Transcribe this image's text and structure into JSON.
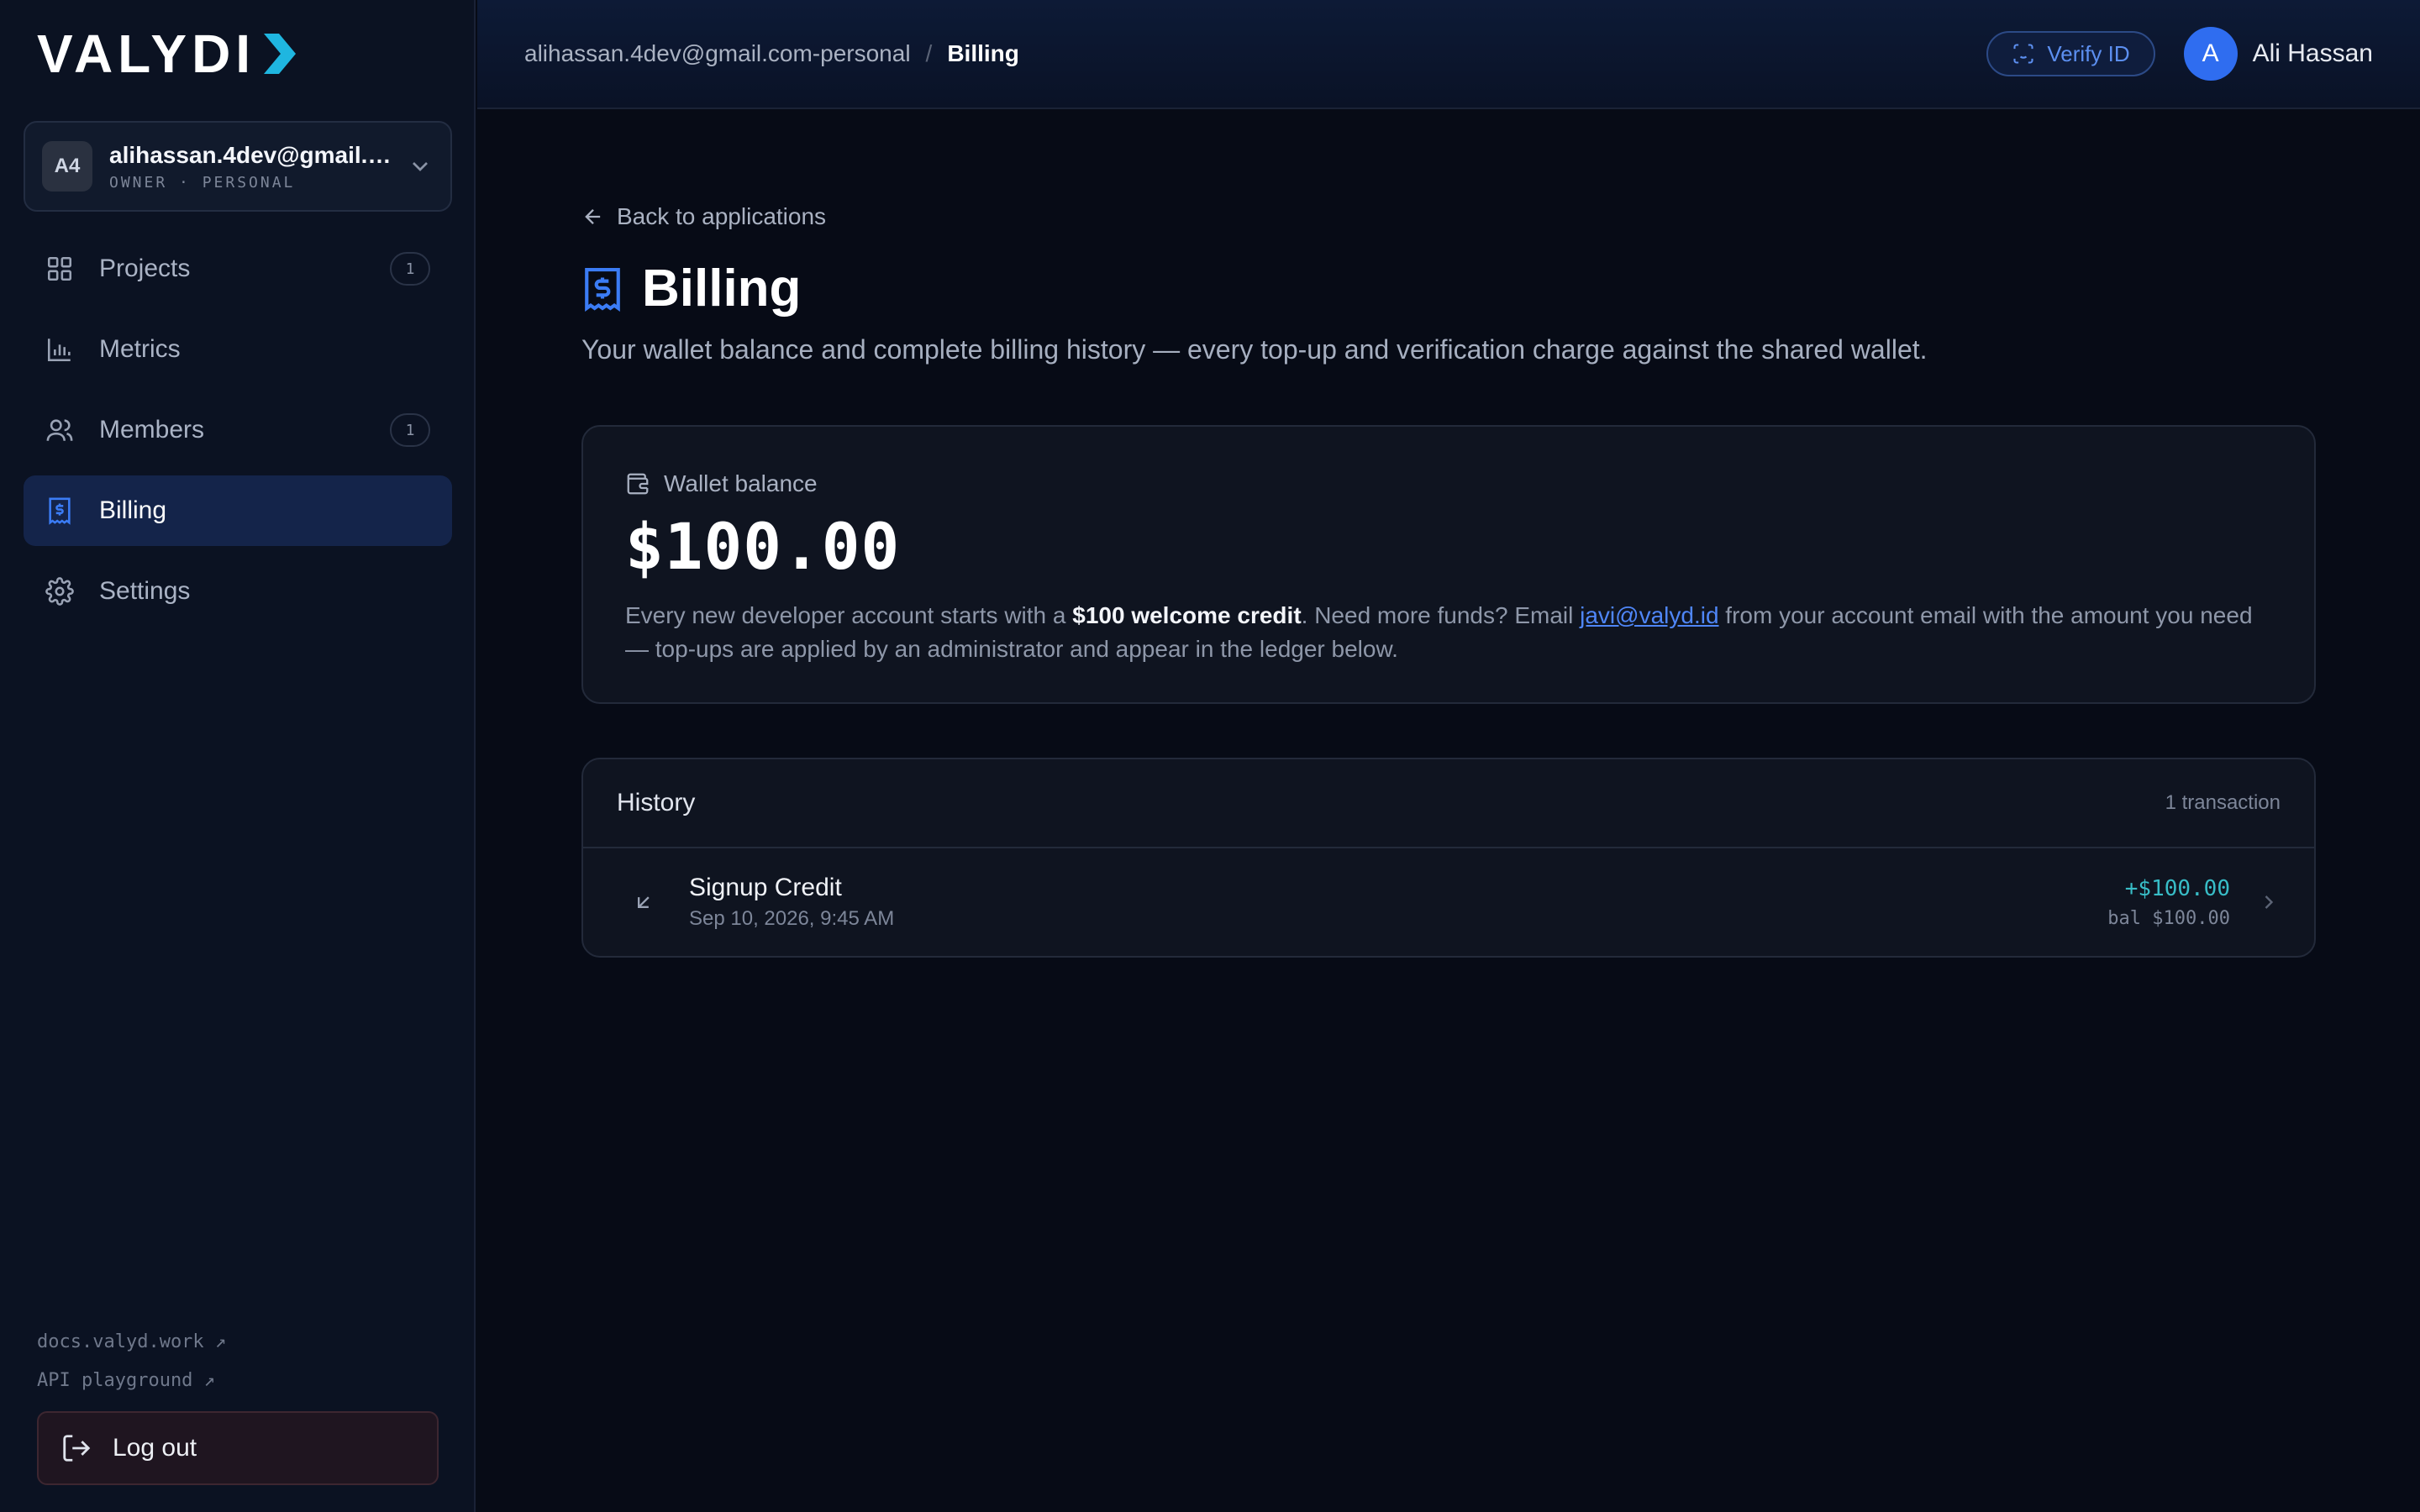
{
  "brand": {
    "logo_text": "VALYDI"
  },
  "account": {
    "avatar_initials": "A4",
    "email": "alihassan.4dev@gmail.c...",
    "role": "OWNER · PERSONAL"
  },
  "nav": {
    "items": [
      {
        "label": "Projects",
        "icon": "grid-icon",
        "badge": "1"
      },
      {
        "label": "Metrics",
        "icon": "bar-chart-icon"
      },
      {
        "label": "Members",
        "icon": "users-icon",
        "badge": "1"
      },
      {
        "label": "Billing",
        "icon": "receipt-dollar-icon",
        "active": true
      },
      {
        "label": "Settings",
        "icon": "gear-icon"
      }
    ]
  },
  "footer": {
    "docs_link": "docs.valyd.work ↗",
    "playground_link": "API playground ↗",
    "logout_label": "Log out"
  },
  "topbar": {
    "breadcrumb_parent": "alihassan.4dev@gmail.com-personal",
    "breadcrumb_sep": "/",
    "breadcrumb_current": "Billing",
    "verify_label": "Verify ID",
    "user_initial": "A",
    "user_name": "Ali Hassan"
  },
  "page": {
    "back_label": "Back to applications",
    "title": "Billing",
    "subtitle": "Your wallet balance and complete billing history — every top-up and verification charge against the shared wallet."
  },
  "wallet": {
    "label": "Wallet balance",
    "amount": "$100.00",
    "note_1": "Every new developer account starts with a ",
    "note_bold": "$100 welcome credit",
    "note_2": ". Need more funds? Email ",
    "note_email": "javi@valyd.id",
    "note_3": " from your account email with the amount you need — top-ups are applied by an administrator and appear in the ledger below."
  },
  "history": {
    "title": "History",
    "count": "1 transaction",
    "rows": [
      {
        "name": "Signup Credit",
        "date": "Sep 10, 2026, 9:45 AM",
        "amount": "+$100.00",
        "balance": "bal $100.00"
      }
    ]
  },
  "colors": {
    "accent": "#2f6df0",
    "link": "#4f86f7",
    "credit": "#38bdc7",
    "logo_mark": "#1fb6e0"
  }
}
